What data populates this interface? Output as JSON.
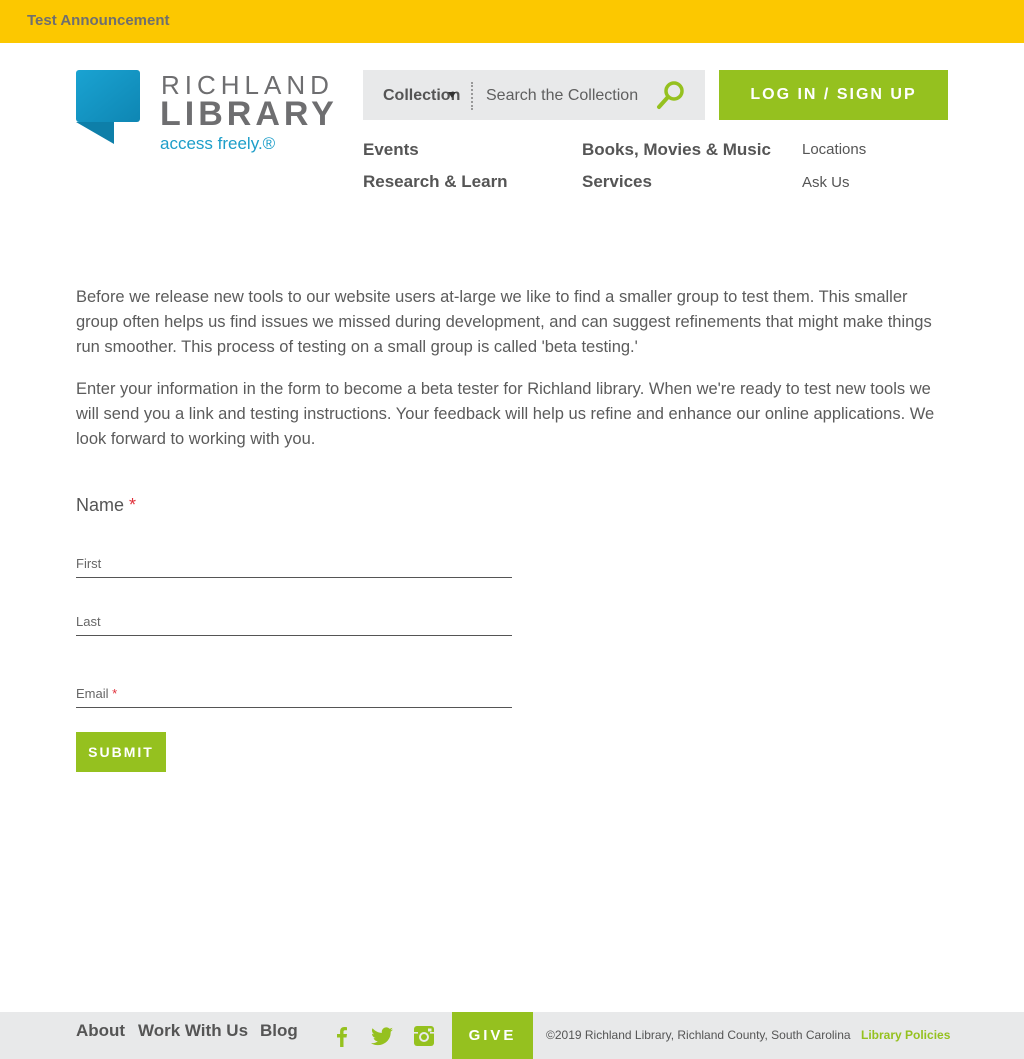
{
  "announcement": {
    "text": "Test Announcement"
  },
  "logo": {
    "line1": "RICHLAND",
    "line2": "LIBRARY",
    "tagline": "access freely.®",
    "brand_color": "#1d9ec9"
  },
  "search": {
    "scope_label": "Collection",
    "placeholder": "Search the Collection",
    "icon": "search-icon"
  },
  "login": {
    "label": "LOG IN / SIGN UP"
  },
  "nav": {
    "primary": [
      "Events",
      "Research & Learn",
      "Books, Movies & Music",
      "Services"
    ],
    "secondary": [
      "Locations",
      "Ask Us"
    ]
  },
  "content": {
    "paragraph1": "Before we release new tools to our website users at-large we like to find a smaller group to test them. This smaller group often helps us find issues we missed during development, and can suggest refinements that might make things run smoother. This process of testing on a small group is called 'beta testing.'",
    "paragraph2": "Enter your information in the form to become a beta tester for Richland library. When we're ready to test new tools we will send you a link and testing instructions. Your feedback will help us refine and enhance our online applications. We look forward to working with you."
  },
  "form": {
    "name_label": "Name",
    "required_mark": "*",
    "first_label": "First",
    "last_label": "Last",
    "email_label": "Email",
    "submit_label": "SUBMIT"
  },
  "footer": {
    "links": [
      "About",
      "Work With Us",
      "Blog"
    ],
    "social": [
      "facebook-icon",
      "twitter-icon",
      "instagram-icon"
    ],
    "give_label": "GIVE",
    "copyright": "©2019 Richland Library, Richland County, South Carolina",
    "policies_label": "Library Policies"
  },
  "colors": {
    "announcement_bg": "#fcc800",
    "accent_green": "#95c11f",
    "required_red": "#e0303a"
  }
}
